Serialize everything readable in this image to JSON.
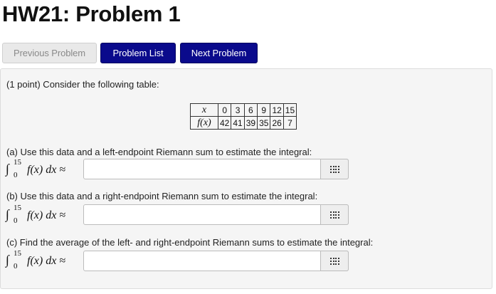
{
  "header": {
    "title": "HW21: Problem 1"
  },
  "nav": {
    "previous_label": "Previous Problem",
    "list_label": "Problem List",
    "next_label": "Next Problem"
  },
  "problem": {
    "intro": "(1 point) Consider the following table:",
    "table": {
      "x_label": "x",
      "f_label": "f(x)",
      "x_values": [
        "0",
        "3",
        "6",
        "9",
        "12",
        "15"
      ],
      "f_values": [
        "42",
        "41",
        "39",
        "35",
        "26",
        "7"
      ]
    },
    "integral": {
      "lower": "0",
      "upper": "15",
      "expression": "f(x) dx ≈"
    },
    "parts": [
      {
        "text": "(a) Use this data and a left-endpoint Riemann sum to estimate the integral:",
        "answer_value": ""
      },
      {
        "text": "(b) Use this data and a right-endpoint Riemann sum to estimate the integral:",
        "answer_value": ""
      },
      {
        "text": "(c) Find the average of the left- and right-endpoint Riemann sums to estimate the integral:",
        "answer_value": ""
      }
    ],
    "palette_icon": "grid-icon"
  },
  "colors": {
    "primary_button": "#0a0a8c",
    "disabled_button": "#e9e9e9",
    "well_background": "#f5f5f5"
  }
}
